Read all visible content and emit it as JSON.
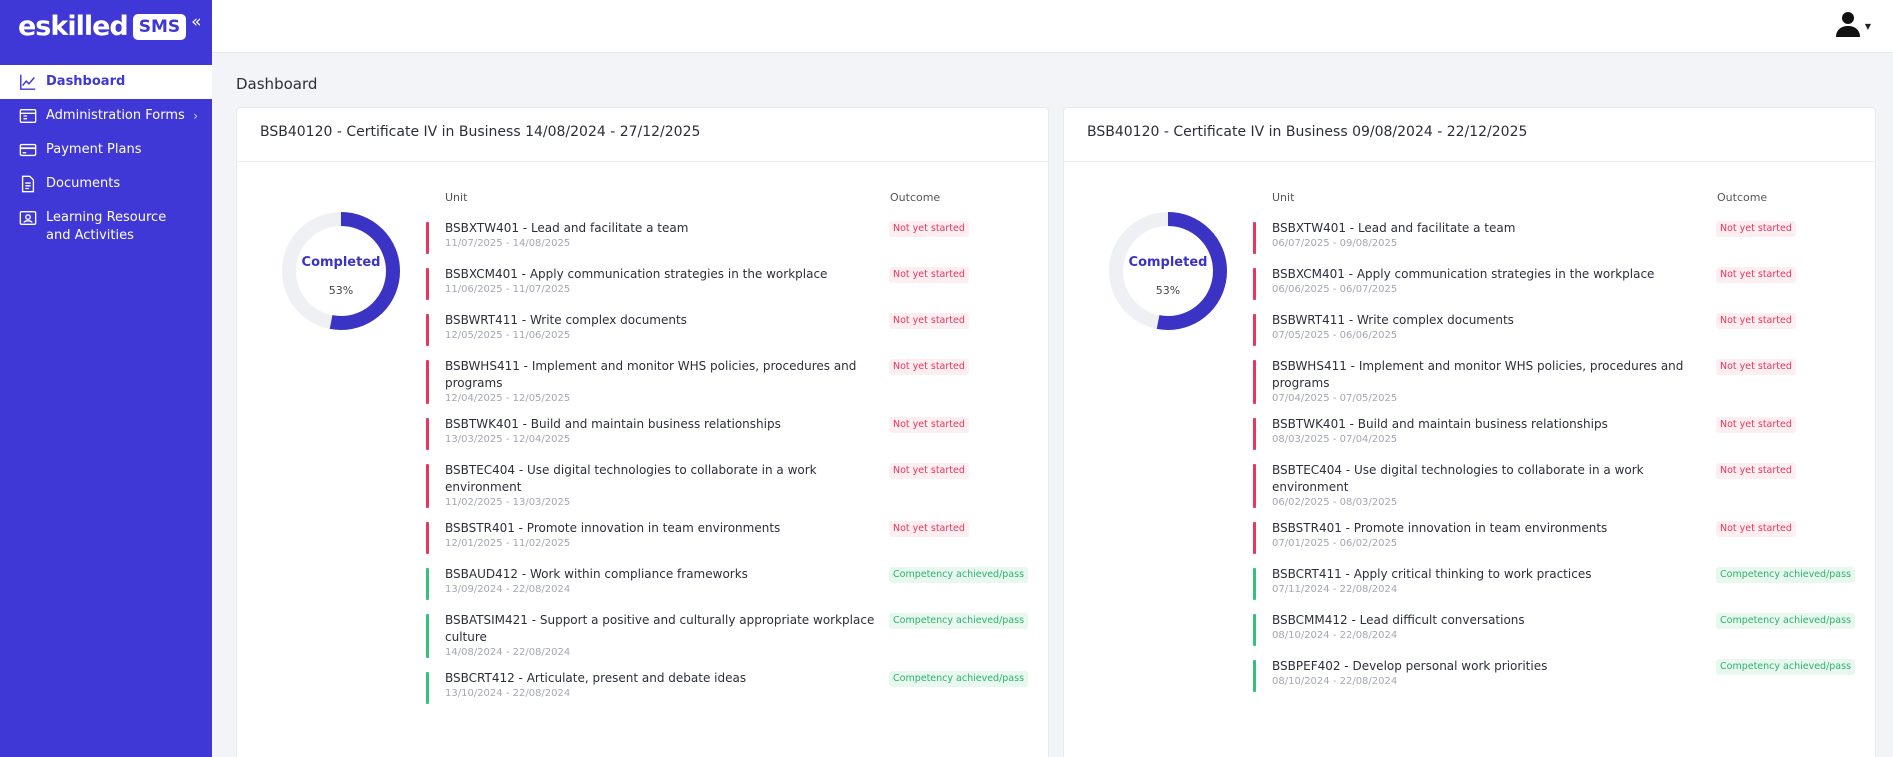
{
  "brand": {
    "logo_text": "eskilled",
    "badge": "SMS",
    "collapse": "«"
  },
  "sidebar": {
    "items": [
      {
        "label": "Dashboard",
        "icon": "chart-line-icon",
        "active": true
      },
      {
        "label": "Administration Forms",
        "icon": "forms-icon",
        "has_submenu": true
      },
      {
        "label": "Payment Plans",
        "icon": "credit-card-icon"
      },
      {
        "label": "Documents",
        "icon": "document-icon"
      },
      {
        "label": "Learning Resource and Activities",
        "icon": "id-card-icon"
      }
    ]
  },
  "header": {
    "user_icon": "user-icon"
  },
  "page": {
    "title": "Dashboard"
  },
  "colors": {
    "accent": "#3f37d6",
    "red": "#e8365d",
    "green": "#34c27a"
  },
  "cards": [
    {
      "title": "BSB40120 - Certificate IV in Business 14/08/2024 - 27/12/2025",
      "progress": {
        "label": "Completed",
        "percent": 53,
        "percent_text": "53%"
      },
      "col_unit": "Unit",
      "col_outcome": "Outcome",
      "units": [
        {
          "name": "BSBXTW401 - Lead and facilitate a team",
          "dates": "11/07/2025 - 14/08/2025",
          "outcome": "Not yet started",
          "status": "red"
        },
        {
          "name": "BSBXCM401 - Apply communication strategies in the workplace",
          "dates": "11/06/2025 - 11/07/2025",
          "outcome": "Not yet started",
          "status": "red"
        },
        {
          "name": "BSBWRT411 - Write complex documents",
          "dates": "12/05/2025 - 11/06/2025",
          "outcome": "Not yet started",
          "status": "red"
        },
        {
          "name": "BSBWHS411 - Implement and monitor WHS policies, procedures and programs",
          "dates": "12/04/2025 - 12/05/2025",
          "outcome": "Not yet started",
          "status": "red"
        },
        {
          "name": "BSBTWK401 - Build and maintain business relationships",
          "dates": "13/03/2025 - 12/04/2025",
          "outcome": "Not yet started",
          "status": "red"
        },
        {
          "name": "BSBTEC404 - Use digital technologies to collaborate in a work environment",
          "dates": "11/02/2025 - 13/03/2025",
          "outcome": "Not yet started",
          "status": "red"
        },
        {
          "name": "BSBSTR401 - Promote innovation in team environments",
          "dates": "12/01/2025 - 11/02/2025",
          "outcome": "Not yet started",
          "status": "red"
        },
        {
          "name": "BSBAUD412 - Work within compliance frameworks",
          "dates": "13/09/2024 - 22/08/2024",
          "outcome": "Competency achieved/pass",
          "status": "green"
        },
        {
          "name": "BSBATSIM421 - Support a positive and culturally appropriate workplace culture",
          "dates": "14/08/2024 - 22/08/2024",
          "outcome": "Competency achieved/pass",
          "status": "green"
        },
        {
          "name": "BSBCRT412 - Articulate, present and debate ideas",
          "dates": "13/10/2024 - 22/08/2024",
          "outcome": "Competency achieved/pass",
          "status": "green"
        }
      ]
    },
    {
      "title": "BSB40120 - Certificate IV in Business 09/08/2024 - 22/12/2025",
      "progress": {
        "label": "Completed",
        "percent": 53,
        "percent_text": "53%"
      },
      "col_unit": "Unit",
      "col_outcome": "Outcome",
      "units": [
        {
          "name": "BSBXTW401 - Lead and facilitate a team",
          "dates": "06/07/2025 - 09/08/2025",
          "outcome": "Not yet started",
          "status": "red"
        },
        {
          "name": "BSBXCM401 - Apply communication strategies in the workplace",
          "dates": "06/06/2025 - 06/07/2025",
          "outcome": "Not yet started",
          "status": "red"
        },
        {
          "name": "BSBWRT411 - Write complex documents",
          "dates": "07/05/2025 - 06/06/2025",
          "outcome": "Not yet started",
          "status": "red"
        },
        {
          "name": "BSBWHS411 - Implement and monitor WHS policies, procedures and programs",
          "dates": "07/04/2025 - 07/05/2025",
          "outcome": "Not yet started",
          "status": "red"
        },
        {
          "name": "BSBTWK401 - Build and maintain business relationships",
          "dates": "08/03/2025 - 07/04/2025",
          "outcome": "Not yet started",
          "status": "red"
        },
        {
          "name": "BSBTEC404 - Use digital technologies to collaborate in a work environment",
          "dates": "06/02/2025 - 08/03/2025",
          "outcome": "Not yet started",
          "status": "red"
        },
        {
          "name": "BSBSTR401 - Promote innovation in team environments",
          "dates": "07/01/2025 - 06/02/2025",
          "outcome": "Not yet started",
          "status": "red"
        },
        {
          "name": "BSBCRT411 - Apply critical thinking to work practices",
          "dates": "07/11/2024 - 22/08/2024",
          "outcome": "Competency achieved/pass",
          "status": "green"
        },
        {
          "name": "BSBCMM412 - Lead difficult conversations",
          "dates": "08/10/2024 - 22/08/2024",
          "outcome": "Competency achieved/pass",
          "status": "green"
        },
        {
          "name": "BSBPEF402 - Develop personal work priorities",
          "dates": "08/10/2024 - 22/08/2024",
          "outcome": "Competency achieved/pass",
          "status": "green"
        }
      ]
    }
  ]
}
